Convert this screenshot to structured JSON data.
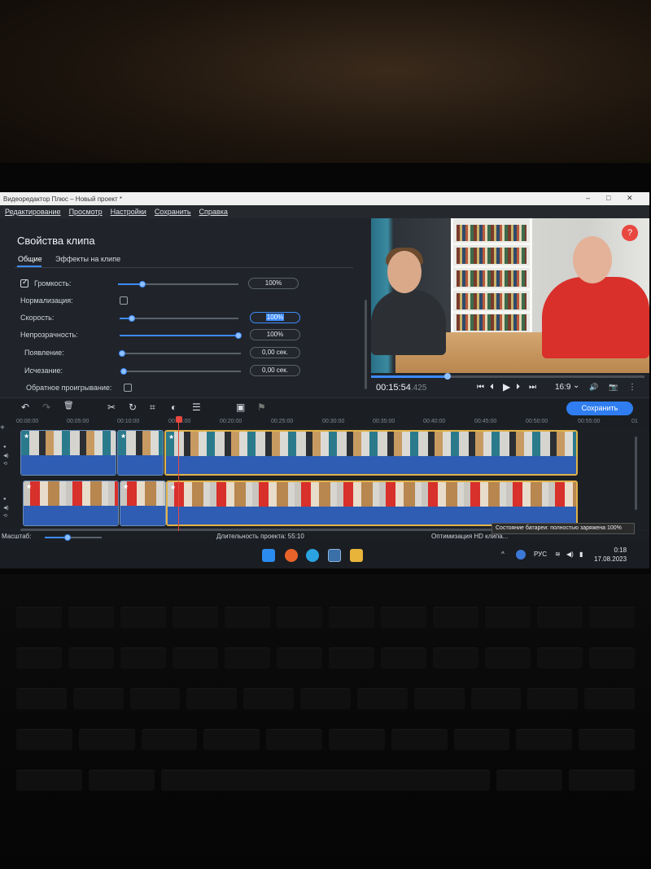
{
  "window": {
    "title": "Видеоредактор Плюс – Новый проект *",
    "minimize": "–",
    "maximize": "□",
    "close": "✕"
  },
  "menu": [
    "Редактирование",
    "Просмотр",
    "Настройки",
    "Сохранить",
    "Справка"
  ],
  "props": {
    "title": "Свойства клипа",
    "tabs": [
      "Общие",
      "Эффекты на клипе"
    ],
    "rows": {
      "volume": {
        "label": "Громкость:",
        "value": "100%",
        "level": 0.2,
        "checked": true
      },
      "normalize": {
        "label": "Нормализация:",
        "checked": false
      },
      "speed": {
        "label": "Скорость:",
        "value": "100%",
        "level": 0.1
      },
      "opacity": {
        "label": "Непрозрачность:",
        "value": "100%",
        "level": 1.0
      },
      "fadein": {
        "label": "Появление:",
        "value": "0,00 сек.",
        "level": 0.0
      },
      "fadeout": {
        "label": "Исчезание:",
        "value": "0,00 сек.",
        "level": 0.0
      },
      "reverse": {
        "label": "Обратное проигрывание:",
        "checked": false
      }
    }
  },
  "preview": {
    "help": "?",
    "timecode": "00:15:54",
    "timecode_ms": ".425",
    "progress": 0.28,
    "aspect": "16:9",
    "aspect_chevron": "⌄",
    "btn_start": "⏮",
    "btn_prev": "⏴",
    "btn_play": "▶",
    "btn_next": "⏵",
    "btn_end": "⏭",
    "btn_volume": "🔊",
    "btn_snapshot": "📷",
    "btn_more": "⋮"
  },
  "toolbar": {
    "save": "Сохранить",
    "undo": "↶",
    "redo": "↷",
    "delete": "🗑",
    "cut": "✂",
    "rotate": "↻",
    "crop": "⌗",
    "color": "◐",
    "adjust": "☰",
    "overlay": "▣",
    "marker": "⚑"
  },
  "ruler": [
    "00:00:00",
    "00:05:00",
    "00:10:00",
    "00:15:00",
    "00:20:00",
    "00:25:00",
    "00:30:00",
    "00:35:00",
    "00:40:00",
    "00:45:00",
    "00:50:00",
    "00:55:00",
    "01"
  ],
  "tracks": {
    "add": "+",
    "video_icon": "●",
    "audio_icon": "◀)",
    "link_icon": "⟲",
    "clip_star": "★"
  },
  "status": {
    "scale": "Масштаб:",
    "zoom_level": 0.4,
    "duration": "Длительность проекта:  55:10",
    "optimize": "Оптимизация HD клипа...",
    "battery_tooltip": "Состояние батареи: полностью заряжена 100%"
  },
  "taskbar": {
    "tray_lang": "РУС",
    "time": "0:18",
    "date": "17.08.2023",
    "tray_up": "^",
    "tray_wifi": "≋",
    "tray_volume": "◀)",
    "tray_battery": "▮"
  }
}
